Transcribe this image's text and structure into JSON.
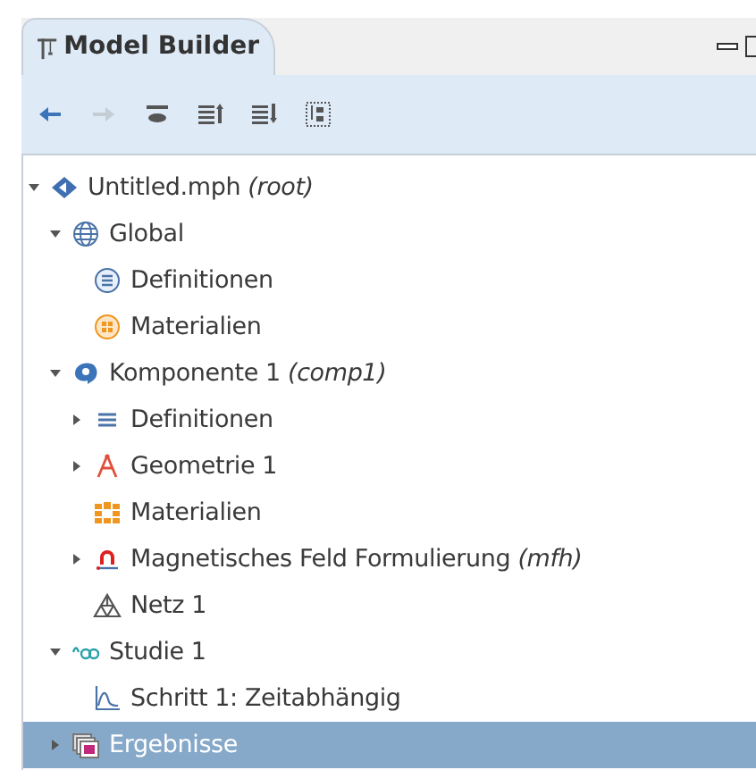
{
  "panel": {
    "title": "Model Builder"
  },
  "toolbar": [
    {
      "kind": "back",
      "disabled": false
    },
    {
      "kind": "forward",
      "disabled": true
    },
    {
      "kind": "show",
      "disabled": false
    },
    {
      "kind": "move-up",
      "disabled": false
    },
    {
      "kind": "move-down",
      "disabled": false
    },
    {
      "kind": "tree",
      "disabled": false
    }
  ],
  "tree": [
    {
      "kind": "root",
      "label": "Untitled.mph",
      "suffix": "(root)",
      "expanded": true,
      "selected": false,
      "children": [
        {
          "kind": "global",
          "label": "Global",
          "expanded": true,
          "selected": false,
          "children": [
            {
              "kind": "definitions-circle",
              "label": "Definitionen",
              "selected": false
            },
            {
              "kind": "materials-circle",
              "label": "Materialien",
              "selected": false
            }
          ]
        },
        {
          "kind": "component",
          "label": "Komponente 1",
          "suffix": "(comp1)",
          "expanded": true,
          "selected": false,
          "children": [
            {
              "kind": "definitions",
              "label": "Definitionen",
              "expanded": false,
              "selected": false
            },
            {
              "kind": "geometry",
              "label": "Geometrie 1",
              "expanded": false,
              "selected": false
            },
            {
              "kind": "materials",
              "label": "Materialien",
              "selected": false
            },
            {
              "kind": "magnet",
              "label": "Magnetisches Feld Formulierung",
              "suffix": "(mfh)",
              "expanded": false,
              "selected": false
            },
            {
              "kind": "mesh",
              "label": "Netz 1",
              "selected": false
            }
          ]
        },
        {
          "kind": "study",
          "label": "Studie 1",
          "expanded": true,
          "selected": false,
          "children": [
            {
              "kind": "step",
              "label": "Schritt 1: Zeitabhängig",
              "selected": false
            }
          ]
        },
        {
          "kind": "results",
          "label": "Ergebnisse",
          "expanded": false,
          "selected": true
        }
      ]
    }
  ]
}
